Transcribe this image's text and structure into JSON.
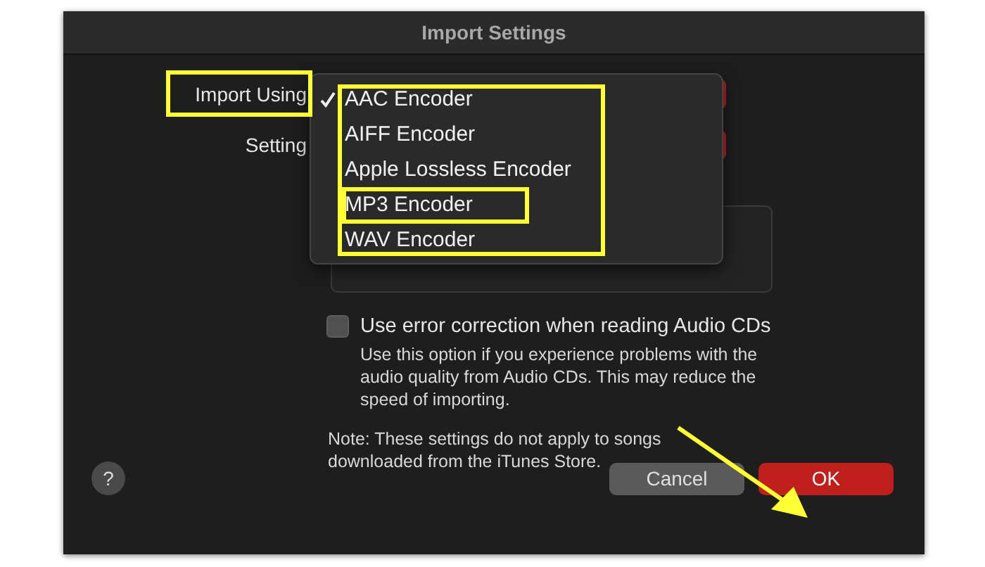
{
  "window": {
    "title": "Import Settings"
  },
  "fields": [
    {
      "label": "Import Using"
    },
    {
      "label": "Setting"
    }
  ],
  "menu": {
    "items": [
      {
        "label": "AAC Encoder",
        "checked": true
      },
      {
        "label": "AIFF Encoder",
        "checked": false
      },
      {
        "label": "Apple Lossless Encoder",
        "checked": false
      },
      {
        "label": "MP3 Encoder",
        "checked": false
      },
      {
        "label": "WAV Encoder",
        "checked": false
      }
    ]
  },
  "error_correction": {
    "label": "Use error correction when reading Audio CDs",
    "checked": false,
    "description": "Use this option if you experience problems with the audio quality from Audio CDs. This may reduce the speed of importing."
  },
  "note": "Note: These settings do not apply to songs downloaded from the iTunes Store.",
  "help": {
    "label": "?"
  },
  "buttons": [
    {
      "label": "Cancel",
      "kind": "cancel"
    },
    {
      "label": "OK",
      "kind": "default"
    }
  ]
}
